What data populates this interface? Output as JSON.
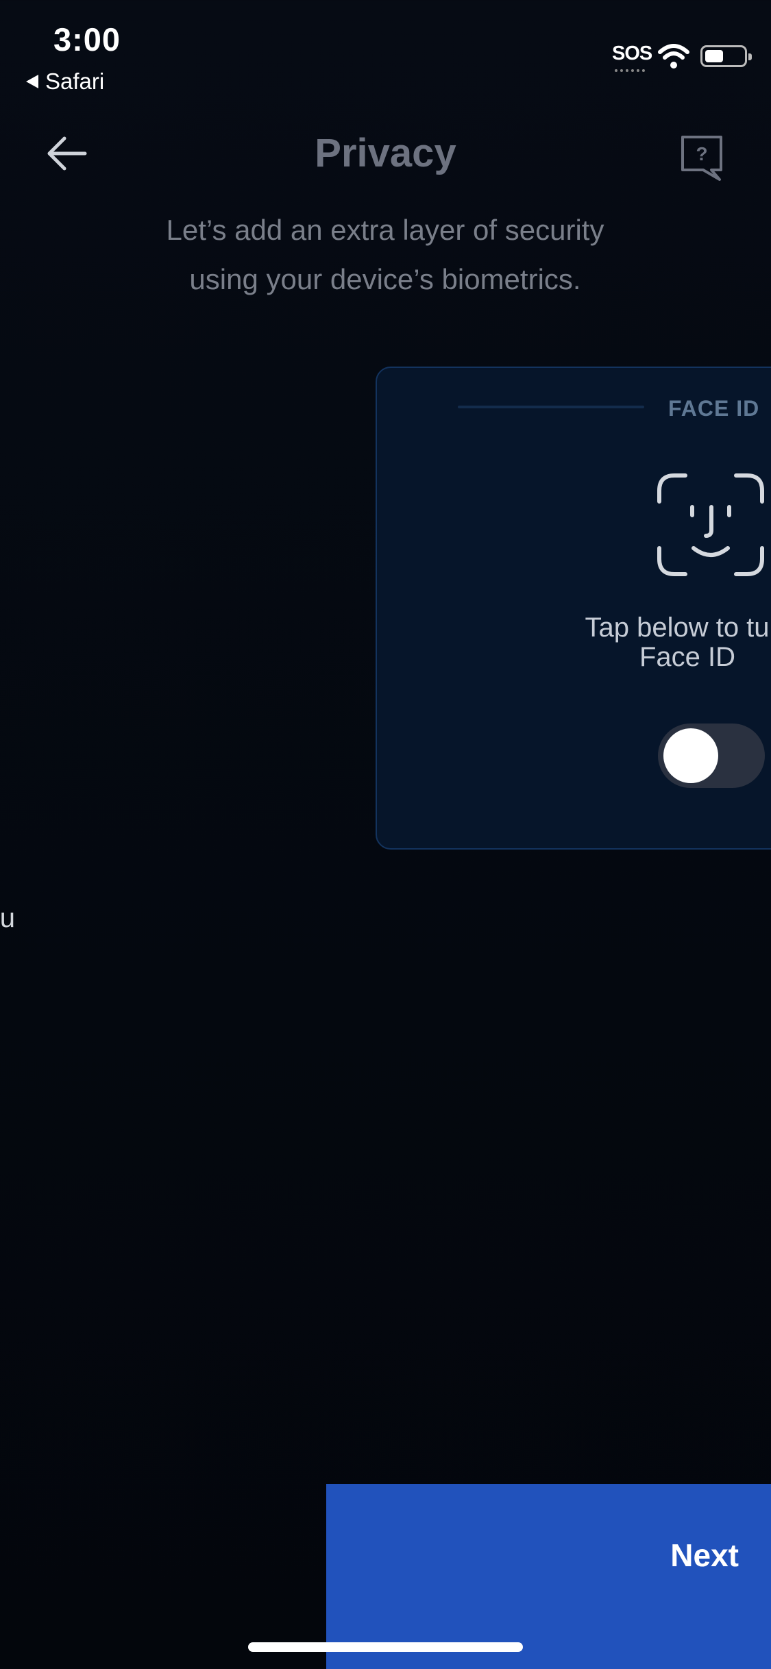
{
  "status_bar": {
    "time": "3:00",
    "back_app": "Safari",
    "carrier": "SOS",
    "icons": [
      "wifi-icon",
      "battery-icon"
    ]
  },
  "header": {
    "title": "Privacy",
    "back_icon": "arrow-left-icon",
    "help_icon": "help-question-icon",
    "help_glyph": "?"
  },
  "subtitle_lines": [
    "Let’s add an extra layer of security",
    "using your device’s biometrics."
  ],
  "card": {
    "label": "FACE ID",
    "icon": "face-id-icon",
    "text_line1": "Tap below to tu",
    "text_line2": "Face ID",
    "toggle_on": false
  },
  "offscreen_fragment": "u!",
  "footer": {
    "next_label": "Next"
  },
  "colors": {
    "background": "#04080f",
    "card_bg": "#06152a",
    "card_border": "#13335e",
    "button": "#2152bc",
    "title_gray": "#6d7280"
  }
}
